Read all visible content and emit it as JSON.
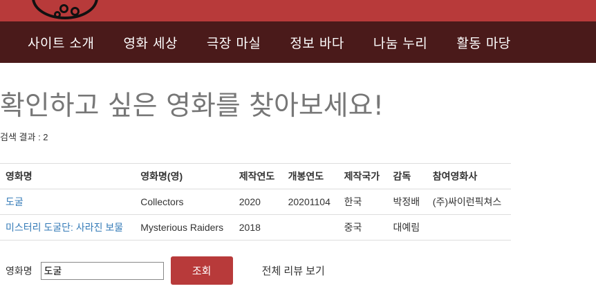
{
  "nav": {
    "items": [
      "사이트 소개",
      "영화 세상",
      "극장 마실",
      "정보 바다",
      "나눔 누리",
      "활동 마당"
    ]
  },
  "main": {
    "title": "확인하고 싶은 영화를 찾아보세요!",
    "result_count": "검색 결과 : 2"
  },
  "table": {
    "headers": [
      "영화명",
      "영화명(영)",
      "제작연도",
      "개봉연도",
      "제작국가",
      "감독",
      "참여영화사"
    ],
    "rows": [
      [
        "도굴",
        "Collectors",
        "2020",
        "20201104",
        "한국",
        "박정배",
        "(주)싸이런픽쳐스"
      ],
      [
        "미스터리 도굴단: 사라진 보물",
        "Mysterious Raiders",
        "2018",
        "",
        "중국",
        "대예림",
        ""
      ]
    ]
  },
  "search": {
    "label": "영화명",
    "value": "도굴",
    "button_label": "조회",
    "all_reviews_label": "전체 리뷰 보기"
  },
  "colors": {
    "brand": "#b83a3a",
    "nav_bg": "#4a1a1a",
    "link": "#337ab7"
  }
}
